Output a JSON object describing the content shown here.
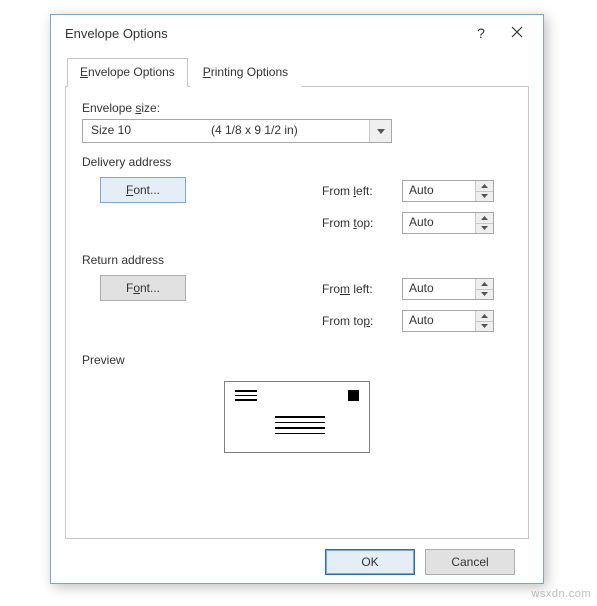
{
  "watermark": "wsxdn.com",
  "dialog": {
    "title": "Envelope Options",
    "help_aria": "Help",
    "close_aria": "Close"
  },
  "tabs": {
    "envelope": {
      "label_prefix": "E",
      "label_rest": "nvelope Options"
    },
    "printing": {
      "label_prefix": "P",
      "label_rest": "rinting Options"
    }
  },
  "panel": {
    "size_label_prefix": "Envelope ",
    "size_label_underline": "s",
    "size_label_suffix": "ize:",
    "size_name": "Size 10",
    "size_dim": "(4 1/8 x 9 1/2 in)",
    "delivery": {
      "title": "Delivery address",
      "font_prefix": "",
      "font_underline": "F",
      "font_suffix": "ont...",
      "from_left_prefix": "From ",
      "from_left_underline": "l",
      "from_left_suffix": "eft:",
      "from_left_value": "Auto",
      "from_top_prefix": "From ",
      "from_top_underline": "t",
      "from_top_suffix": "op:",
      "from_top_value": "Auto"
    },
    "return": {
      "title": "Return address",
      "font_prefix": "F",
      "font_underline": "o",
      "font_suffix": "nt...",
      "from_left_prefix": "Fro",
      "from_left_underline": "m",
      "from_left_suffix": " left:",
      "from_left_value": "Auto",
      "from_top_prefix": "From to",
      "from_top_underline": "p",
      "from_top_suffix": ":",
      "from_top_value": "Auto"
    },
    "preview_title": "Preview"
  },
  "footer": {
    "ok": "OK",
    "cancel": "Cancel"
  }
}
